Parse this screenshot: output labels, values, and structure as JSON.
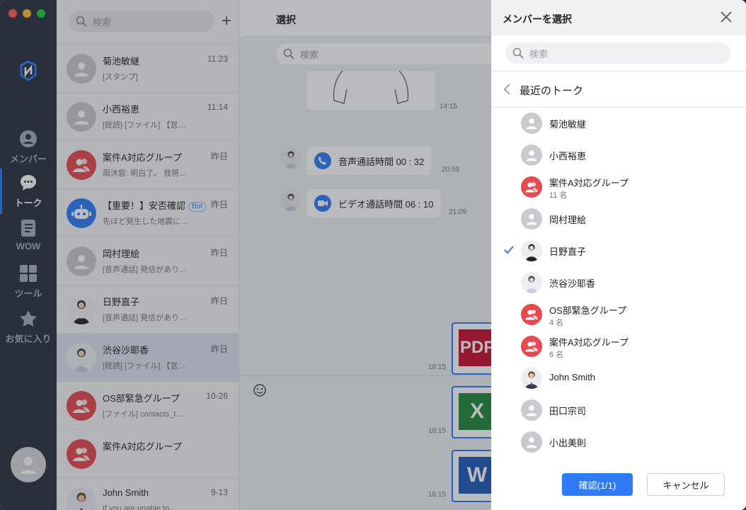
{
  "rail": {
    "items": [
      {
        "label": "メンバー",
        "icon": "person-icon"
      },
      {
        "label": "トーク",
        "icon": "chat-bubble-icon"
      },
      {
        "label": "WOW",
        "icon": "notebook-icon"
      },
      {
        "label": "ツール",
        "icon": "grid-icon"
      },
      {
        "label": "お気に入り",
        "icon": "star-icon"
      }
    ]
  },
  "list": {
    "search_placeholder": "検索",
    "items": [
      {
        "name": "菊池敏継",
        "time": "11:23",
        "preview": "[スタンプ]",
        "avatar": "gray"
      },
      {
        "name": "小西裕恵",
        "time": "11:14",
        "preview": "[既読] [ファイル] 【営…",
        "avatar": "gray"
      },
      {
        "name": "案件A対応グループ",
        "time": "昨日",
        "preview": "周沐宸: 明白了。 我将…",
        "avatar": "red"
      },
      {
        "name": "【重要！】安否確認",
        "badge": "Bot",
        "time": "昨日",
        "preview": "先ほど発生した地震に…",
        "avatar": "blue"
      },
      {
        "name": "岡村理絵",
        "time": "昨日",
        "preview": "[音声通話] 発信があり…",
        "avatar": "gray"
      },
      {
        "name": "日野直子",
        "time": "昨日",
        "preview": "[音声通話] 発信があり…",
        "avatar": "photo"
      },
      {
        "name": "渋谷沙耶香",
        "time": "昨日",
        "preview": "[既読] [ファイル] 【営…",
        "avatar": "photo"
      },
      {
        "name": "OS部緊急グループ",
        "time": "10-26",
        "preview": "[ファイル] contacts_t…",
        "avatar": "red"
      },
      {
        "name": "案件A対応グループ",
        "time": "",
        "preview": "",
        "avatar": "red"
      },
      {
        "name": "John Smith",
        "time": "9-13",
        "preview": "If you are unable to…",
        "avatar": "photo"
      }
    ]
  },
  "chat": {
    "title": "選択",
    "search_placeholder": "検索",
    "messages": [
      {
        "text": "音声通話時間 00 : 32",
        "time": "20:59"
      },
      {
        "text": "ビデオ通話時間 06 : 10",
        "time": "21:09"
      }
    ],
    "image_time": "14:15",
    "files": [
      {
        "type": "PDF",
        "time": "18:15"
      },
      {
        "type": "X",
        "time": "18:15"
      },
      {
        "type": "W",
        "time": "18:15"
      }
    ]
  },
  "modal": {
    "title": "メンバーを選択",
    "search_placeholder": "検索",
    "section": "最近のトーク",
    "members": [
      {
        "name": "菊池敏継",
        "count": "",
        "avatar": "gray",
        "checked": false
      },
      {
        "name": "小西裕恵",
        "count": "",
        "avatar": "gray",
        "checked": false
      },
      {
        "name": "案件A対応グループ",
        "count": "11 名",
        "avatar": "red",
        "checked": false
      },
      {
        "name": "岡村理絵",
        "count": "",
        "avatar": "gray",
        "checked": false
      },
      {
        "name": "日野直子",
        "count": "",
        "avatar": "photo",
        "checked": true
      },
      {
        "name": "渋谷沙耶香",
        "count": "",
        "avatar": "photo",
        "checked": false
      },
      {
        "name": "OS部緊急グループ",
        "count": "4 名",
        "avatar": "red",
        "checked": false
      },
      {
        "name": "案件A対応グループ",
        "count": "6 名",
        "avatar": "red",
        "checked": false
      },
      {
        "name": "John Smith",
        "count": "",
        "avatar": "photo",
        "checked": false
      },
      {
        "name": "田口宗司",
        "count": "",
        "avatar": "gray",
        "checked": false
      },
      {
        "name": "小出美則",
        "count": "",
        "avatar": "gray",
        "checked": false
      }
    ],
    "confirm_label": "確認(1/1)",
    "cancel_label": "キャンセル"
  },
  "colors": {
    "accent": "#2f7bf6",
    "rail": "#2c3140",
    "group_red": "#e8494e"
  }
}
